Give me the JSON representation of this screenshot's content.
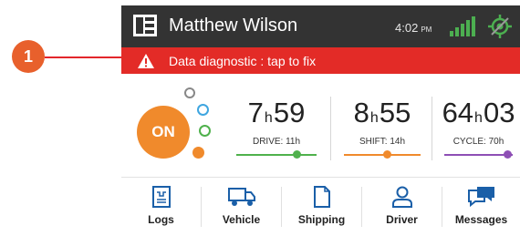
{
  "callout": {
    "number": "1"
  },
  "header": {
    "driver_name": "Matthew Wilson",
    "time": "4:02",
    "ampm": "PM"
  },
  "alert": {
    "text": "Data diagnostic : tap to fix"
  },
  "status": {
    "label": "ON",
    "color": "#f08a2c"
  },
  "timers": [
    {
      "hours": "7",
      "minutes": "59",
      "unit": "h",
      "label": "DRIVE: 11h",
      "color": "#4fb14c",
      "progress": 0.76
    },
    {
      "hours": "8",
      "minutes": "55",
      "unit": "h",
      "label": "SHIFT: 14h",
      "color": "#f08a2c",
      "progress": 0.57
    },
    {
      "hours": "64",
      "minutes": "03",
      "unit": "h",
      "label": "CYCLE: 70h",
      "color": "#8e4fb5",
      "progress": 0.92
    }
  ],
  "nav": [
    {
      "label": "Logs",
      "icon": "logs-icon"
    },
    {
      "label": "Vehicle",
      "icon": "truck-icon"
    },
    {
      "label": "Shipping",
      "icon": "document-icon"
    },
    {
      "label": "Driver",
      "icon": "person-icon"
    },
    {
      "label": "Messages",
      "icon": "messages-icon"
    }
  ],
  "colors": {
    "alert": "#e32b27",
    "header": "#333333",
    "signal": "#4caf50",
    "accent_blue": "#1a5fa8"
  }
}
